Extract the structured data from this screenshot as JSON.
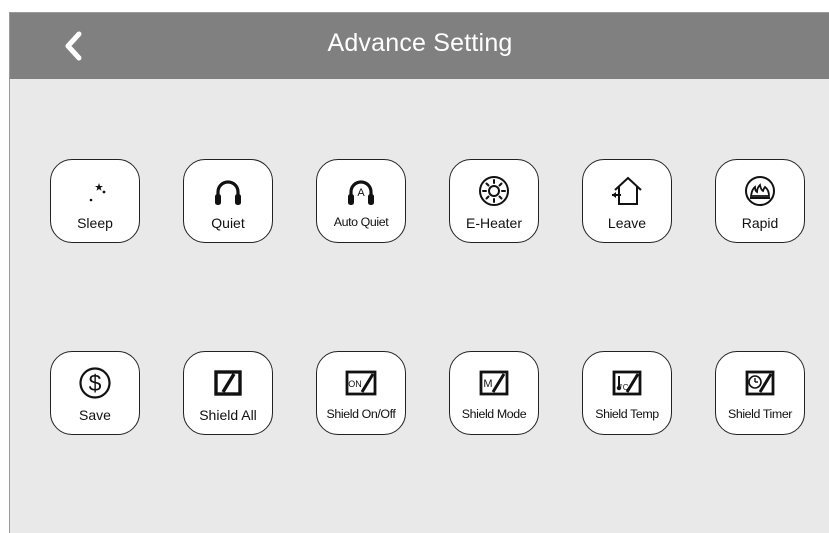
{
  "header": {
    "title": "Advance Setting",
    "back_icon": "chevron-left-icon"
  },
  "rows": [
    [
      {
        "label": "Sleep",
        "icon": "moon-stars-icon"
      },
      {
        "label": "Quiet",
        "icon": "headphones-icon"
      },
      {
        "label": "Auto Quiet",
        "icon": "auto-headphones-icon"
      },
      {
        "label": "E-Heater",
        "icon": "heater-sun-icon"
      },
      {
        "label": "Leave",
        "icon": "leave-home-icon"
      },
      {
        "label": "Rapid",
        "icon": "rapid-flame-icon"
      }
    ],
    [
      {
        "label": "Save",
        "icon": "dollar-circle-icon"
      },
      {
        "label": "Shield All",
        "icon": "shield-all-icon"
      },
      {
        "label": "Shield On/Off",
        "icon": "shield-onoff-icon",
        "icon_text": "ON"
      },
      {
        "label": "Shield Mode",
        "icon": "shield-mode-icon",
        "icon_text": "M"
      },
      {
        "label": "Shield Temp",
        "icon": "shield-temp-icon",
        "icon_text": "°C"
      },
      {
        "label": "Shield Timer",
        "icon": "shield-timer-icon"
      }
    ]
  ],
  "colors": {
    "header": "#808080",
    "background": "#e9e9ea",
    "tile": "#ffffff",
    "stroke": "#222222"
  }
}
